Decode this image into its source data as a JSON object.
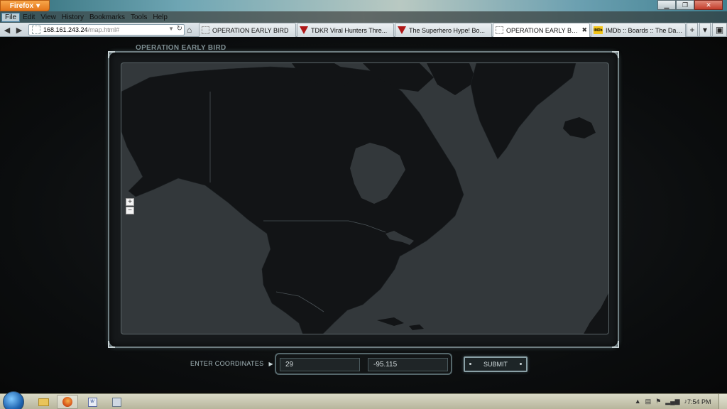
{
  "browser": {
    "app_button_label": "Firefox",
    "menu": [
      "File",
      "Edit",
      "View",
      "History",
      "Bookmarks",
      "Tools",
      "Help"
    ],
    "url_host": "168.161.243.24",
    "url_path": "/map.html#",
    "tabs": [
      {
        "label": "OPERATION EARLY BIRD",
        "favicon": "dashed-page-icon",
        "selected": false
      },
      {
        "label": "TDKR Viral Hunters Thre...",
        "favicon": "shield-icon",
        "selected": false
      },
      {
        "label": "The Superhero Hype! Bo...",
        "favicon": "shield-icon",
        "selected": false
      },
      {
        "label": "OPERATION EARLY BIRD",
        "favicon": "dashed-page-icon",
        "selected": true
      },
      {
        "label": "IMDb :: Boards :: The Dar...",
        "favicon": "imdb-icon",
        "selected": false
      }
    ],
    "imdb_favicon_text": "IMDb"
  },
  "page": {
    "title": "OPERATION EARLY BIRD",
    "map": {
      "zoom_in": "+",
      "zoom_out": "−",
      "region": "North America"
    },
    "coordinates": {
      "label": "ENTER COORDINATES",
      "latitude": "29",
      "longitude": "-95.115"
    },
    "submit_label": "SUBMIT"
  },
  "taskbar": {
    "clock": "7:54 PM",
    "word_icon_text": "W"
  },
  "colors": {
    "page_bg": "#0d0f10",
    "map_ocean": "#33383b",
    "map_land": "#121416",
    "hud_border": "#6f7e82",
    "text_accent": "#a9bcc0"
  }
}
